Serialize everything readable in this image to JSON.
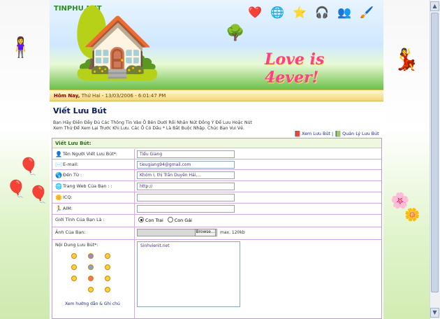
{
  "header": {
    "site_name": "TINPHU.NET",
    "tagline": "Love is 4ever!",
    "date_text": "Thứ Hai - 13/03/2006 - 6:01:47 PM",
    "date_label": "Hôm Nay,"
  },
  "page": {
    "title": "Viết Lưu Bút",
    "intro": "Bạn Hãy Điền Đầy Đủ Các Thông Tin Vào Ô Bên Dưới Rồi Nhấn Nút Đồng Ý Để Lưu Hoặc Nút Xem Thử Để Xem Lại Trước Khi Lưu. Các Ô Có Dấu * Là Bắt Buộc Nhập. Chúc Bạn Vui Vẻ.",
    "link_view": "Xem Lưu Bút",
    "link_manage": "Quản Lý Lưu Bút",
    "separator": "|"
  },
  "form": {
    "heading": "Viết Lưu Bút:",
    "fields": [
      {
        "label": "Tên Người Viết Lưu Bút*:",
        "value": "Tiểu Giang"
      },
      {
        "label": "E-mail:",
        "value": "tieugiang94@gmail.com"
      },
      {
        "label": "Đến Từ :",
        "value": "Khóm I, thị Trấn Duyên Hải,..."
      },
      {
        "label": "Trang Web Của Bạn : :",
        "value": "http://"
      },
      {
        "label": "ICQ:",
        "value": ""
      },
      {
        "label": "AIM:",
        "value": ""
      }
    ],
    "gender_label": "Giới Tính Của Bạn Là :",
    "gender_male": "Con Trai",
    "gender_female": "Con Gái",
    "photo_label": "Ảnh Của Bạn:",
    "browse": "Browse...",
    "max_size": "max. 120kb",
    "message_label": "Nội Dung Lưu Bút*:",
    "message_value": "Sinhvienit.net",
    "guide": "Xem hướng dẫn & Ghi chú"
  },
  "colors": {
    "accent": "#2e6b1f",
    "border": "#d4a7e5",
    "title": "#0b1b5a"
  }
}
